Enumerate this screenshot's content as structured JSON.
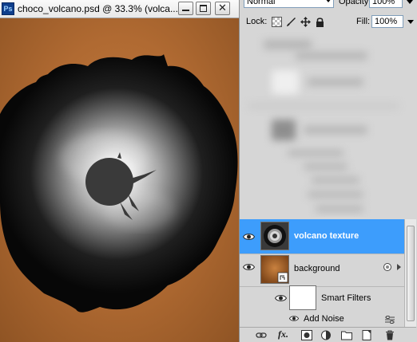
{
  "document": {
    "app_icon_label": "Ps",
    "title": "choco_volcano.psd @ 33.3% (volca...",
    "close_glyph": "✕"
  },
  "layers_panel": {
    "blend_mode": "Normal",
    "opacity_label": "Opacity:",
    "opacity_value": "100%",
    "lock_label": "Lock:",
    "fill_label": "Fill:",
    "fill_value": "100%",
    "layers": [
      {
        "name": "volcano texture",
        "selected": true,
        "visible": true
      },
      {
        "name": "background",
        "selected": false,
        "visible": true,
        "smart_object": true
      },
      {
        "name": "Smart Filters",
        "selected": false,
        "visible": true
      },
      {
        "name": "Add Noise",
        "selected": false,
        "visible": true
      }
    ],
    "bottom_icons": [
      "link-icon",
      "fx-icon",
      "mask-icon",
      "adjustment-icon",
      "folder-icon",
      "new-layer-icon",
      "trash-icon"
    ],
    "fx_label": "fx."
  },
  "colors": {
    "canvas_bg": "#b06a32",
    "selection": "#3d9dfc",
    "panel_bg": "#d6d6d6"
  }
}
